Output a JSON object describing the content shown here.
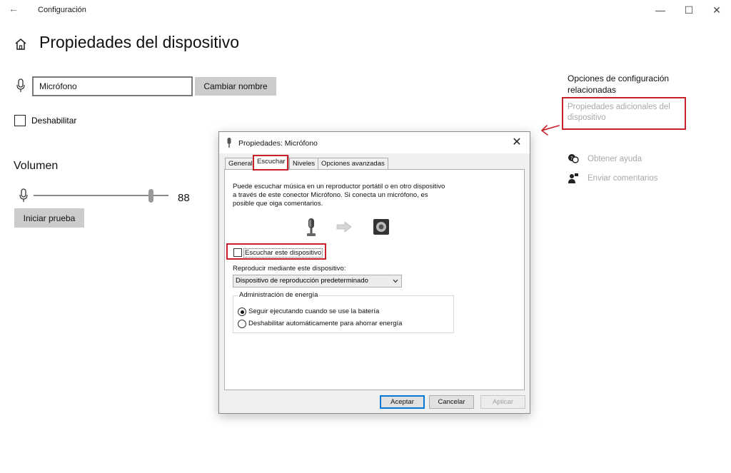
{
  "window": {
    "title": "Configuración",
    "back_glyph": "←",
    "controls": {
      "minimize": "—",
      "maximize": "☐",
      "close": "✕"
    }
  },
  "page": {
    "title": "Propiedades del dispositivo",
    "device_name_value": "Micrófono",
    "rename_button": "Cambiar nombre",
    "disable_label": "Deshabilitar",
    "volume_title": "Volumen",
    "volume_value": "88",
    "test_button": "Iniciar prueba"
  },
  "related": {
    "title": "Opciones de configuración relacionadas",
    "additional_properties": "Propiedades adicionales del dispositivo",
    "get_help": "Obtener ayuda",
    "send_feedback": "Enviar comentarios"
  },
  "dialog": {
    "title": "Propiedades: Micrófono",
    "close_glyph": "✕",
    "tabs": [
      "General",
      "Escuchar",
      "Niveles",
      "Opciones avanzadas"
    ],
    "active_tab": "Escuchar",
    "description": "Puede escuchar música en un reproductor portátil o en otro dispositivo a través de este conector Micrófono. Si conecta un micrófono, es posible que oiga comentarios.",
    "listen_checkbox": "Escuchar este dispositivo",
    "playback_label": "Reproducir mediante este dispositivo:",
    "playback_selected": "Dispositivo de reproducción predeterminado",
    "power_group": "Administración de energía",
    "power_options": [
      "Seguir ejecutando cuando se use la batería",
      "Deshabilitar automáticamente para ahorrar energía"
    ],
    "power_selected_index": 0,
    "buttons": {
      "ok": "Aceptar",
      "cancel": "Cancelar",
      "apply": "Aplicar"
    }
  },
  "colors": {
    "highlight": "#c8202a",
    "primary_button_border": "#0078d7",
    "disabled_text": "#a8a8a8"
  }
}
